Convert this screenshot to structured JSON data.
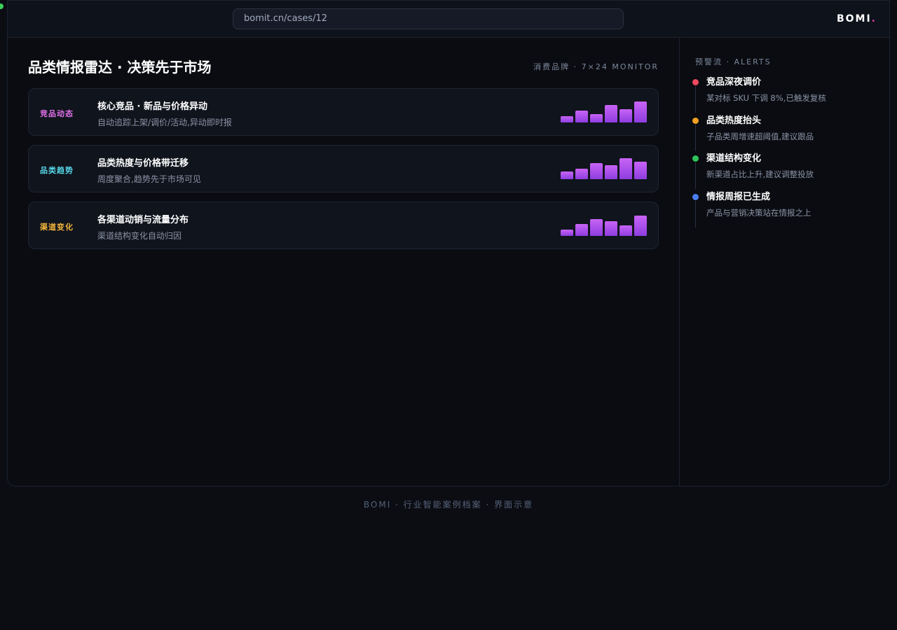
{
  "browser": {
    "url": "bomit.cn/cases/12",
    "brand": "BOMI",
    "brand_dot": "."
  },
  "main": {
    "title": "品类情报雷达 · 决策先于市场",
    "meta": "消费品牌 · 7×24 MONITOR",
    "cards": [
      {
        "tag": "竞品动态",
        "tag_color": "#e070e8",
        "title": "核心竞品 · 新品与价格异动",
        "desc": "自动追踪上架/调价/活动,异动即时报",
        "bars": [
          0.3,
          0.55,
          0.4,
          0.82,
          0.63,
          1.0
        ]
      },
      {
        "tag": "品类趋势",
        "tag_color": "#56d8e8",
        "title": "品类热度与价格带迁移",
        "desc": "周度聚合,趋势先于市场可见",
        "bars": [
          0.38,
          0.5,
          0.78,
          0.65,
          1.0,
          0.82
        ]
      },
      {
        "tag": "渠道变化",
        "tag_color": "#f0b43c",
        "title": "各渠道动销与流量分布",
        "desc": "渠道结构变化自动归因",
        "bars": [
          0.3,
          0.55,
          0.8,
          0.7,
          0.5,
          0.95
        ]
      }
    ]
  },
  "sidebar": {
    "header": "预警流 · ALERTS",
    "alerts": [
      {
        "title": "竞品深夜调价",
        "desc": "某对标 SKU 下调 8%,已触发复核",
        "color": "#f0485e"
      },
      {
        "title": "品类热度抬头",
        "desc": "子品类周增速超阈值,建议跟品",
        "color": "#f0a020"
      },
      {
        "title": "渠道结构变化",
        "desc": "新渠道占比上升,建议调整投放",
        "color": "#2ec45a"
      },
      {
        "title": "情报周报已生成",
        "desc": "产品与营销决策站在情报之上",
        "color": "#4a7ef0"
      }
    ]
  },
  "footer": {
    "text": "BOMI · 行业智能案例档案 · 界面示意"
  }
}
